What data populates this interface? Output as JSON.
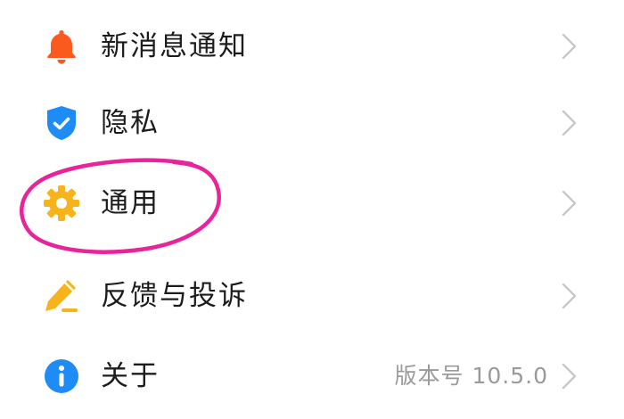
{
  "settings": {
    "items": [
      {
        "label": "新消息通知",
        "icon": "bell-icon",
        "value": ""
      },
      {
        "label": "隐私",
        "icon": "shield-check-icon",
        "value": ""
      },
      {
        "label": "通用",
        "icon": "gear-icon",
        "value": ""
      },
      {
        "label": "反馈与投诉",
        "icon": "pencil-icon",
        "value": ""
      },
      {
        "label": "关于",
        "icon": "info-icon",
        "value": "版本号 10.5.0"
      }
    ]
  },
  "colors": {
    "bell": "#fa5a1e",
    "shield": "#1f8cf5",
    "gear": "#f7b31c",
    "pencil": "#f7b31c",
    "info": "#1f8cf5",
    "highlight": "#e8249b",
    "chevron": "#c8c8c8"
  },
  "annotation": {
    "highlighted_item": "通用"
  }
}
